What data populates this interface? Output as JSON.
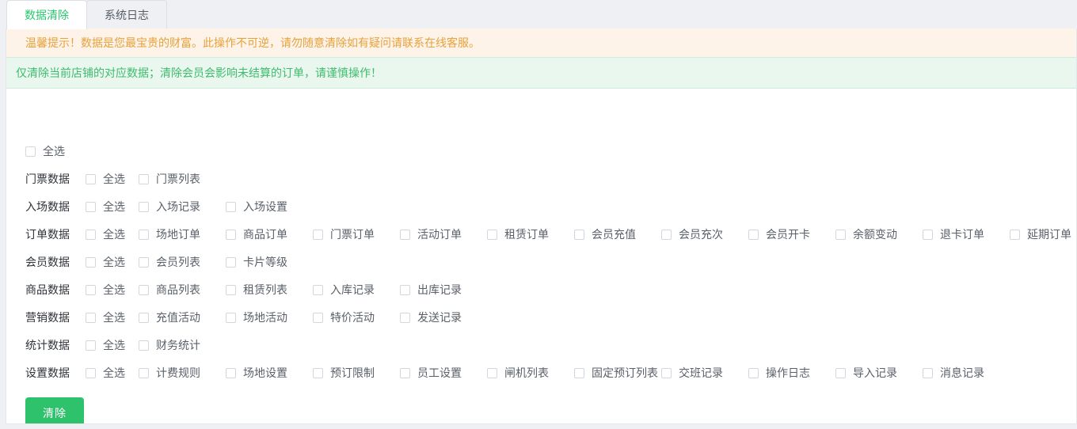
{
  "tabs": [
    {
      "label": "数据清除",
      "active": true
    },
    {
      "label": "系统日志",
      "active": false
    }
  ],
  "alerts": {
    "warning": "温馨提示！数据是您最宝贵的财富。此操作不可逆，请勿随意清除如有疑问请联系在线客服。",
    "success": "仅清除当前店铺的对应数据；清除会员会影响未结算的订单，请谨慎操作！"
  },
  "colors": {
    "accent_green": "#2dc26b",
    "tab_active_text": "#28c76f",
    "warning_bg": "#fdf3e8",
    "warning_text": "#e6a23c",
    "success_bg": "#e9f7ee",
    "success_text": "#3fbb6e",
    "page_bg": "#eef0f4",
    "checkbox_border": "#d3d6dc"
  },
  "select_all": {
    "label": "全选",
    "checked": false
  },
  "rows": [
    {
      "label": "门票数据",
      "items": [
        {
          "label": "全选",
          "checked": false
        },
        {
          "label": "门票列表",
          "checked": false
        }
      ]
    },
    {
      "label": "入场数据",
      "items": [
        {
          "label": "全选",
          "checked": false
        },
        {
          "label": "入场记录",
          "checked": false
        },
        {
          "label": "入场设置",
          "checked": false
        }
      ]
    },
    {
      "label": "订单数据",
      "items": [
        {
          "label": "全选",
          "checked": false
        },
        {
          "label": "场地订单",
          "checked": false
        },
        {
          "label": "商品订单",
          "checked": false
        },
        {
          "label": "门票订单",
          "checked": false
        },
        {
          "label": "活动订单",
          "checked": false
        },
        {
          "label": "租赁订单",
          "checked": false
        },
        {
          "label": "会员充值",
          "checked": false
        },
        {
          "label": "会员充次",
          "checked": false
        },
        {
          "label": "会员开卡",
          "checked": false
        },
        {
          "label": "余额变动",
          "checked": false
        },
        {
          "label": "退卡订单",
          "checked": false
        },
        {
          "label": "延期订单",
          "checked": false
        }
      ]
    },
    {
      "label": "会员数据",
      "items": [
        {
          "label": "全选",
          "checked": false
        },
        {
          "label": "会员列表",
          "checked": false
        },
        {
          "label": "卡片等级",
          "checked": false
        }
      ]
    },
    {
      "label": "商品数据",
      "items": [
        {
          "label": "全选",
          "checked": false
        },
        {
          "label": "商品列表",
          "checked": false
        },
        {
          "label": "租赁列表",
          "checked": false
        },
        {
          "label": "入库记录",
          "checked": false
        },
        {
          "label": "出库记录",
          "checked": false
        }
      ]
    },
    {
      "label": "营销数据",
      "items": [
        {
          "label": "全选",
          "checked": false
        },
        {
          "label": "充值活动",
          "checked": false
        },
        {
          "label": "场地活动",
          "checked": false
        },
        {
          "label": "特价活动",
          "checked": false
        },
        {
          "label": "发送记录",
          "checked": false
        }
      ]
    },
    {
      "label": "统计数据",
      "items": [
        {
          "label": "全选",
          "checked": false
        },
        {
          "label": "财务统计",
          "checked": false
        }
      ]
    },
    {
      "label": "设置数据",
      "items": [
        {
          "label": "全选",
          "checked": false
        },
        {
          "label": "计费规则",
          "checked": false
        },
        {
          "label": "场地设置",
          "checked": false
        },
        {
          "label": "预订限制",
          "checked": false
        },
        {
          "label": "员工设置",
          "checked": false
        },
        {
          "label": "闸机列表",
          "checked": false
        },
        {
          "label": "固定预订列表",
          "checked": false
        },
        {
          "label": "交班记录",
          "checked": false
        },
        {
          "label": "操作日志",
          "checked": false
        },
        {
          "label": "导入记录",
          "checked": false
        },
        {
          "label": "消息记录",
          "checked": false
        }
      ]
    }
  ],
  "clear_button": {
    "label": "清除"
  }
}
